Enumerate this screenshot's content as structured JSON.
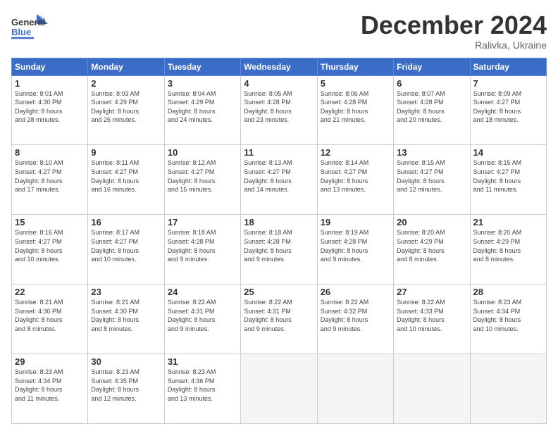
{
  "header": {
    "logo_line1": "General",
    "logo_line2": "Blue",
    "month_title": "December 2024",
    "location": "Ralivka, Ukraine"
  },
  "days_of_week": [
    "Sunday",
    "Monday",
    "Tuesday",
    "Wednesday",
    "Thursday",
    "Friday",
    "Saturday"
  ],
  "weeks": [
    [
      {
        "day": "1",
        "info": "Sunrise: 8:01 AM\nSunset: 4:30 PM\nDaylight: 8 hours\nand 28 minutes."
      },
      {
        "day": "2",
        "info": "Sunrise: 8:03 AM\nSunset: 4:29 PM\nDaylight: 8 hours\nand 26 minutes."
      },
      {
        "day": "3",
        "info": "Sunrise: 8:04 AM\nSunset: 4:29 PM\nDaylight: 8 hours\nand 24 minutes."
      },
      {
        "day": "4",
        "info": "Sunrise: 8:05 AM\nSunset: 4:28 PM\nDaylight: 8 hours\nand 23 minutes."
      },
      {
        "day": "5",
        "info": "Sunrise: 8:06 AM\nSunset: 4:28 PM\nDaylight: 8 hours\nand 21 minutes."
      },
      {
        "day": "6",
        "info": "Sunrise: 8:07 AM\nSunset: 4:28 PM\nDaylight: 8 hours\nand 20 minutes."
      },
      {
        "day": "7",
        "info": "Sunrise: 8:09 AM\nSunset: 4:27 PM\nDaylight: 8 hours\nand 18 minutes."
      }
    ],
    [
      {
        "day": "8",
        "info": "Sunrise: 8:10 AM\nSunset: 4:27 PM\nDaylight: 8 hours\nand 17 minutes."
      },
      {
        "day": "9",
        "info": "Sunrise: 8:11 AM\nSunset: 4:27 PM\nDaylight: 8 hours\nand 16 minutes."
      },
      {
        "day": "10",
        "info": "Sunrise: 8:12 AM\nSunset: 4:27 PM\nDaylight: 8 hours\nand 15 minutes."
      },
      {
        "day": "11",
        "info": "Sunrise: 8:13 AM\nSunset: 4:27 PM\nDaylight: 8 hours\nand 14 minutes."
      },
      {
        "day": "12",
        "info": "Sunrise: 8:14 AM\nSunset: 4:27 PM\nDaylight: 8 hours\nand 13 minutes."
      },
      {
        "day": "13",
        "info": "Sunrise: 8:15 AM\nSunset: 4:27 PM\nDaylight: 8 hours\nand 12 minutes."
      },
      {
        "day": "14",
        "info": "Sunrise: 8:15 AM\nSunset: 4:27 PM\nDaylight: 8 hours\nand 11 minutes."
      }
    ],
    [
      {
        "day": "15",
        "info": "Sunrise: 8:16 AM\nSunset: 4:27 PM\nDaylight: 8 hours\nand 10 minutes."
      },
      {
        "day": "16",
        "info": "Sunrise: 8:17 AM\nSunset: 4:27 PM\nDaylight: 8 hours\nand 10 minutes."
      },
      {
        "day": "17",
        "info": "Sunrise: 8:18 AM\nSunset: 4:28 PM\nDaylight: 8 hours\nand 9 minutes."
      },
      {
        "day": "18",
        "info": "Sunrise: 8:18 AM\nSunset: 4:28 PM\nDaylight: 8 hours\nand 9 minutes."
      },
      {
        "day": "19",
        "info": "Sunrise: 8:19 AM\nSunset: 4:28 PM\nDaylight: 8 hours\nand 9 minutes."
      },
      {
        "day": "20",
        "info": "Sunrise: 8:20 AM\nSunset: 4:29 PM\nDaylight: 8 hours\nand 8 minutes."
      },
      {
        "day": "21",
        "info": "Sunrise: 8:20 AM\nSunset: 4:29 PM\nDaylight: 8 hours\nand 8 minutes."
      }
    ],
    [
      {
        "day": "22",
        "info": "Sunrise: 8:21 AM\nSunset: 4:30 PM\nDaylight: 8 hours\nand 8 minutes."
      },
      {
        "day": "23",
        "info": "Sunrise: 8:21 AM\nSunset: 4:30 PM\nDaylight: 8 hours\nand 8 minutes."
      },
      {
        "day": "24",
        "info": "Sunrise: 8:22 AM\nSunset: 4:31 PM\nDaylight: 8 hours\nand 9 minutes."
      },
      {
        "day": "25",
        "info": "Sunrise: 8:22 AM\nSunset: 4:31 PM\nDaylight: 8 hours\nand 9 minutes."
      },
      {
        "day": "26",
        "info": "Sunrise: 8:22 AM\nSunset: 4:32 PM\nDaylight: 8 hours\nand 9 minutes."
      },
      {
        "day": "27",
        "info": "Sunrise: 8:22 AM\nSunset: 4:33 PM\nDaylight: 8 hours\nand 10 minutes."
      },
      {
        "day": "28",
        "info": "Sunrise: 8:23 AM\nSunset: 4:34 PM\nDaylight: 8 hours\nand 10 minutes."
      }
    ],
    [
      {
        "day": "29",
        "info": "Sunrise: 8:23 AM\nSunset: 4:34 PM\nDaylight: 8 hours\nand 11 minutes."
      },
      {
        "day": "30",
        "info": "Sunrise: 8:23 AM\nSunset: 4:35 PM\nDaylight: 8 hours\nand 12 minutes."
      },
      {
        "day": "31",
        "info": "Sunrise: 8:23 AM\nSunset: 4:36 PM\nDaylight: 8 hours\nand 13 minutes."
      },
      {
        "day": "",
        "info": ""
      },
      {
        "day": "",
        "info": ""
      },
      {
        "day": "",
        "info": ""
      },
      {
        "day": "",
        "info": ""
      }
    ]
  ]
}
